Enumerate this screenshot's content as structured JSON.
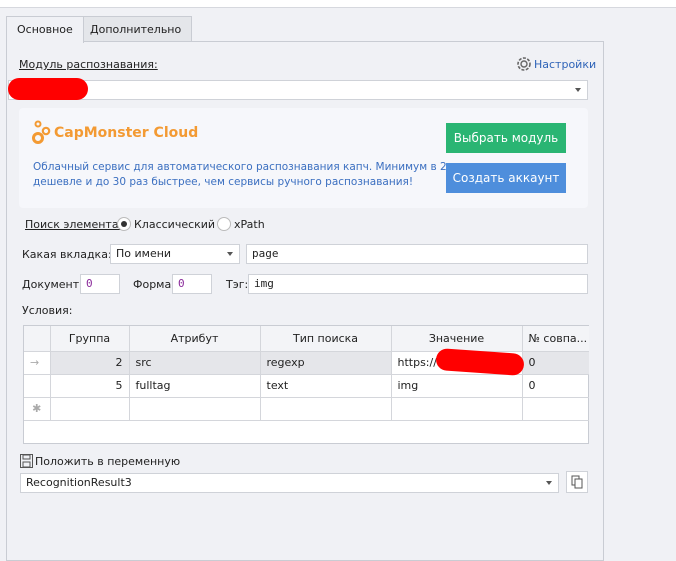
{
  "tabs": [
    {
      "label": "Основное"
    },
    {
      "label": "Дополнительно"
    }
  ],
  "module": {
    "label": "Модуль распознавания:",
    "settings": "Настройки",
    "selected": ""
  },
  "card": {
    "title": "CapMonster Cloud",
    "desc_line1": "Облачный сервис для автоматического распознавания капч. Минимум в 2 раза",
    "desc_line2": "дешевле и до 30 раз быстрее, чем сервисы ручного распознавания!",
    "choose": "Выбрать модуль",
    "create": "Создать аккаунт",
    "colors": {
      "title": "#f39a33",
      "choose": "#2ab573",
      "create": "#4e8edc"
    }
  },
  "search": {
    "label": "Поиск элемента:",
    "classic": "Классический",
    "xpath": "xPath",
    "selected": "classic"
  },
  "tabrow": {
    "label": "Какая вкладка:",
    "mode": "По имени",
    "value": "page"
  },
  "docrow": {
    "doc_label": "Документ:",
    "doc": "0",
    "form_label": "Форма:",
    "form": "0",
    "tag_label": "Тэг:",
    "tag": "img"
  },
  "conditions": {
    "label": "Условия:",
    "headers": [
      "Группа",
      "Атрибут",
      "Тип поиска",
      "Значение",
      "№ совпа..."
    ],
    "rows": [
      [
        "2",
        "src",
        "regexp",
        "https://i",
        "0"
      ],
      [
        "5",
        "fulltag",
        "text",
        "img",
        "0"
      ]
    ]
  },
  "variable": {
    "label": "Положить в переменную",
    "value": "RecognitionResult3"
  }
}
